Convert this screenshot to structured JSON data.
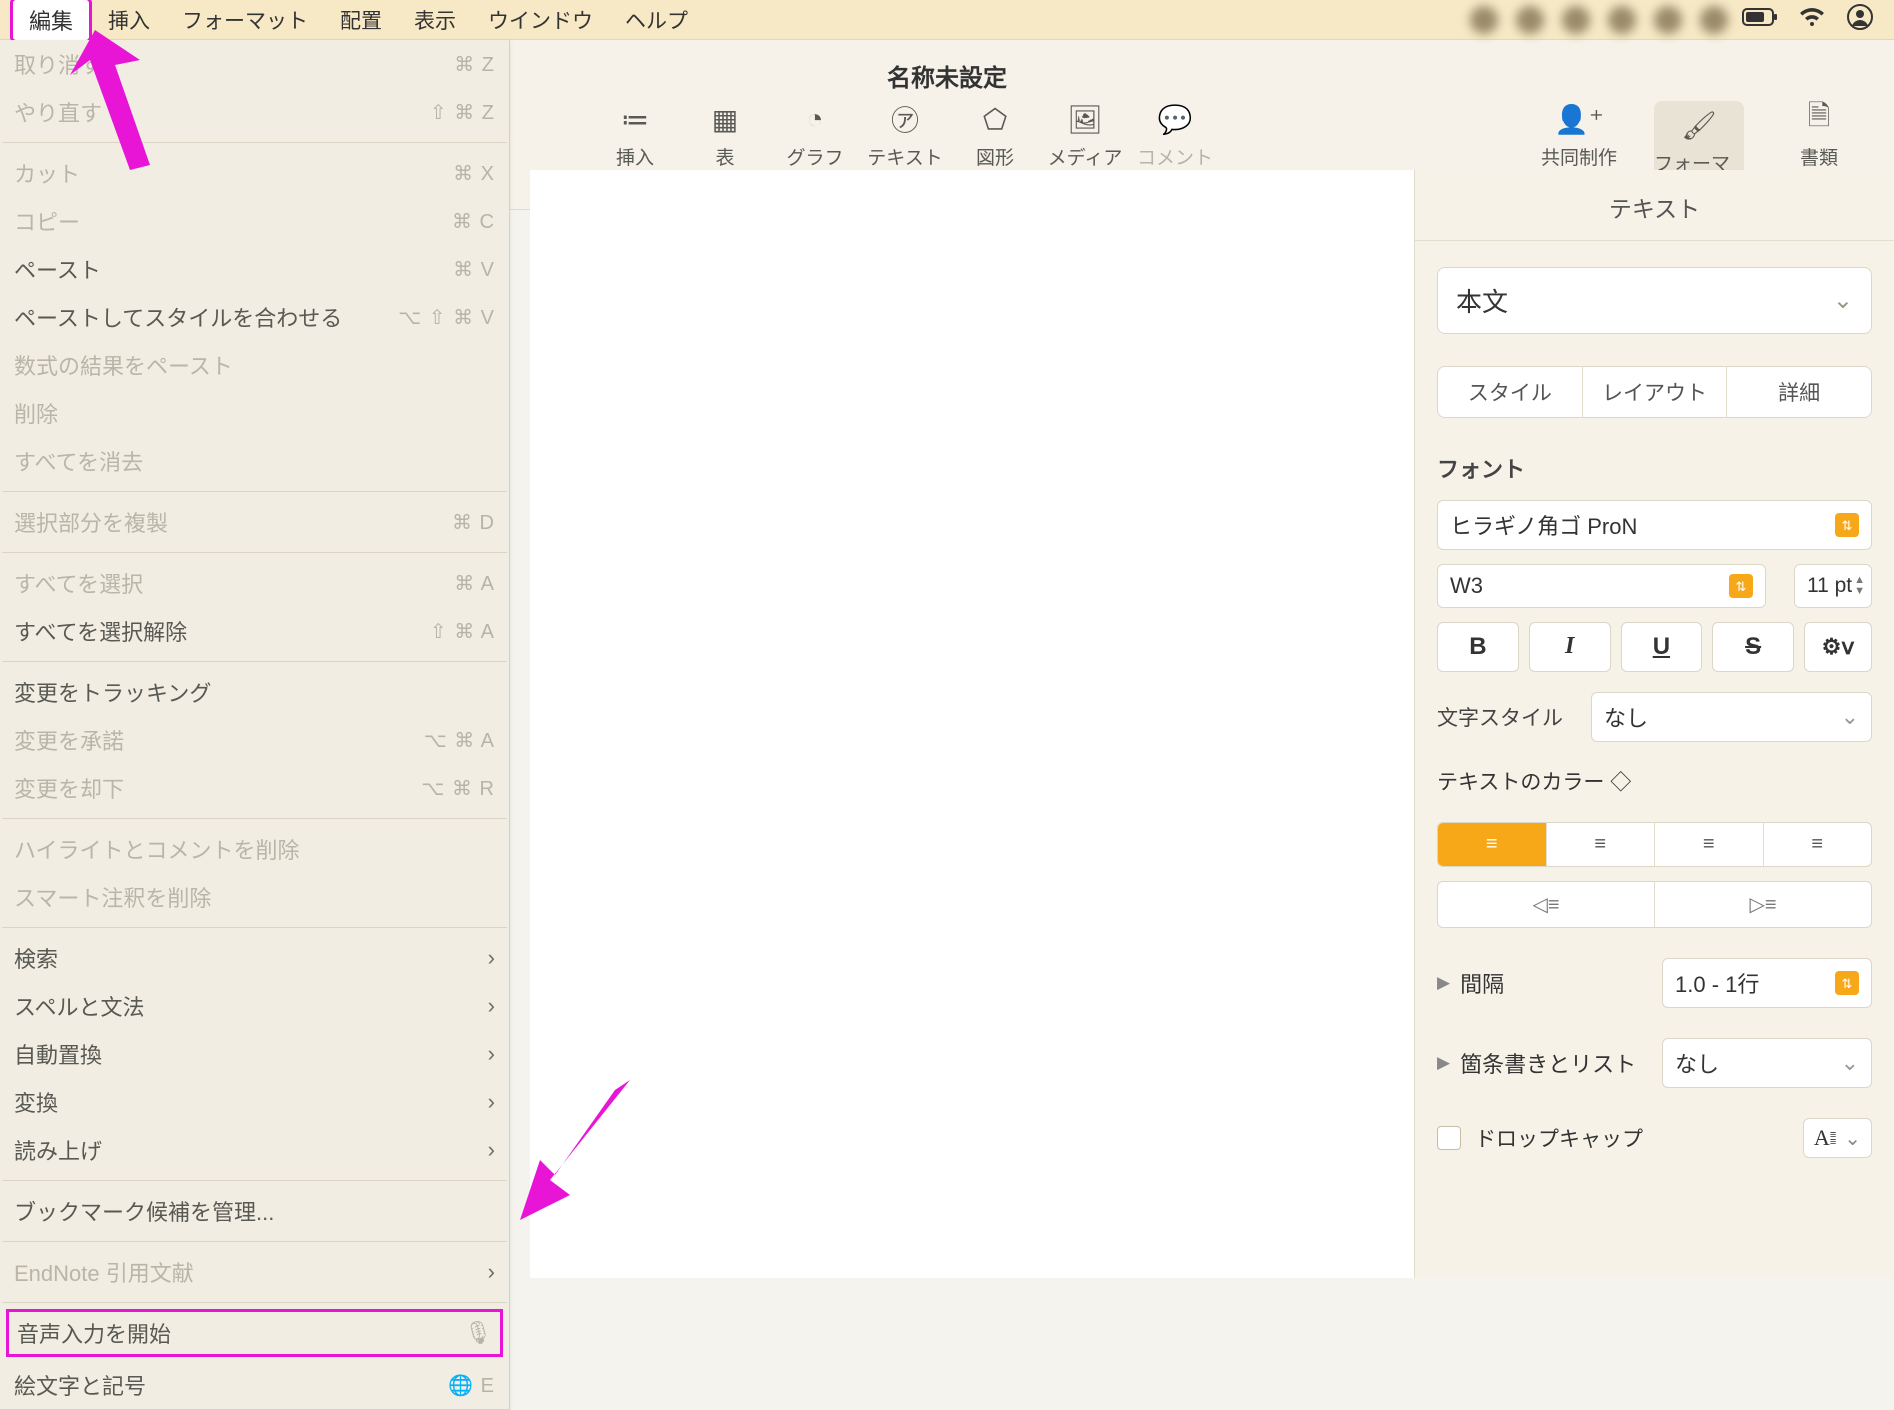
{
  "menubar": {
    "items": [
      "編集",
      "挿入",
      "フォーマット",
      "配置",
      "表示",
      "ウインドウ",
      "ヘルプ"
    ]
  },
  "dropdown": {
    "g1": [
      {
        "label": "取り消す",
        "shortcut": "⌘ Z",
        "dis": true
      },
      {
        "label": "やり直す",
        "shortcut": "⇧ ⌘ Z",
        "dis": true
      }
    ],
    "g2": [
      {
        "label": "カット",
        "shortcut": "⌘ X",
        "dis": true
      },
      {
        "label": "コピー",
        "shortcut": "⌘ C",
        "dis": true
      },
      {
        "label": "ペースト",
        "shortcut": "⌘ V",
        "dis": false
      },
      {
        "label": "ペーストしてスタイルを合わせる",
        "shortcut": "⌥ ⇧ ⌘ V",
        "dis": false
      },
      {
        "label": "数式の結果をペースト",
        "shortcut": "",
        "dis": true
      },
      {
        "label": "削除",
        "shortcut": "",
        "dis": true
      },
      {
        "label": "すべてを消去",
        "shortcut": "",
        "dis": true
      }
    ],
    "g3": [
      {
        "label": "選択部分を複製",
        "shortcut": "⌘ D",
        "dis": true
      }
    ],
    "g4": [
      {
        "label": "すべてを選択",
        "shortcut": "⌘ A",
        "dis": true
      },
      {
        "label": "すべてを選択解除",
        "shortcut": "⇧ ⌘ A",
        "dis": false
      }
    ],
    "g5": [
      {
        "label": "変更をトラッキング",
        "shortcut": "",
        "dis": false
      },
      {
        "label": "変更を承諾",
        "shortcut": "⌥ ⌘ A",
        "dis": true
      },
      {
        "label": "変更を却下",
        "shortcut": "⌥ ⌘ R",
        "dis": true
      }
    ],
    "g6": [
      {
        "label": "ハイライトとコメントを削除",
        "shortcut": "",
        "dis": true
      },
      {
        "label": "スマート注釈を削除",
        "shortcut": "",
        "dis": true
      }
    ],
    "g7": [
      {
        "label": "検索",
        "sub": true,
        "dis": false
      },
      {
        "label": "スペルと文法",
        "sub": true,
        "dis": false
      },
      {
        "label": "自動置換",
        "sub": true,
        "dis": false
      },
      {
        "label": "変換",
        "sub": true,
        "dis": false
      },
      {
        "label": "読み上げ",
        "sub": true,
        "dis": false
      }
    ],
    "g8": [
      {
        "label": "ブックマーク候補を管理...",
        "dis": false
      }
    ],
    "g9": [
      {
        "label": "EndNote 引用文献",
        "sub": true,
        "dis": true
      }
    ],
    "g10": [
      {
        "label": "音声入力を開始",
        "icon": "mic",
        "dis": false,
        "hl": true
      },
      {
        "label": "絵文字と記号",
        "shortcut": "🌐 E",
        "dis": false
      }
    ]
  },
  "title": "名称未設定",
  "toolbar": {
    "items": [
      {
        "label": "挿入",
        "icon": "≔"
      },
      {
        "label": "表",
        "icon": "▦"
      },
      {
        "label": "グラフ",
        "icon": "◔"
      },
      {
        "label": "テキスト",
        "icon": "㋐"
      },
      {
        "label": "図形",
        "icon": "⬠"
      },
      {
        "label": "メディア",
        "icon": "🖼"
      },
      {
        "label": "コメント",
        "icon": "💬",
        "dis": true
      }
    ],
    "collab": "共同制作",
    "format": "フォーマット",
    "doc": "書類"
  },
  "inspector": {
    "tab": "テキスト",
    "style": "本文",
    "segtabs": [
      "スタイル",
      "レイアウト",
      "詳細"
    ],
    "fontTitle": "フォント",
    "fontName": "ヒラギノ角ゴ ProN",
    "weight": "W3",
    "size": "11 pt",
    "charStyleL": "文字スタイル",
    "charStyleV": "なし",
    "textColorL": "テキストのカラー ◇",
    "spacingL": "間隔",
    "spacingV": "1.0 - 1行",
    "bulletsL": "箇条書きとリスト",
    "bulletsV": "なし",
    "dropcapL": "ドロップキャップ"
  }
}
